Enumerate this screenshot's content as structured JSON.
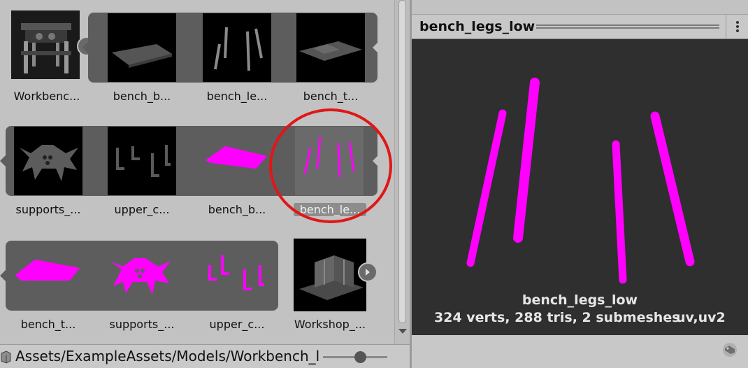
{
  "assets": {
    "row1": [
      {
        "name": "Workbenc...",
        "type": "prefab"
      },
      {
        "name": "bench_b...",
        "type": "mesh"
      },
      {
        "name": "bench_le...",
        "type": "mesh"
      },
      {
        "name": "bench_t...",
        "type": "mesh"
      }
    ],
    "row2": [
      {
        "name": "supports_...",
        "type": "mesh"
      },
      {
        "name": "upper_c...",
        "type": "mesh"
      },
      {
        "name": "bench_b...",
        "type": "mesh"
      },
      {
        "name": "bench_le...",
        "type": "mesh",
        "selected": true
      }
    ],
    "row3": [
      {
        "name": "bench_t...",
        "type": "mesh"
      },
      {
        "name": "supports_...",
        "type": "mesh"
      },
      {
        "name": "upper_c...",
        "type": "mesh"
      },
      {
        "name": "Workshop_...",
        "type": "prefab"
      }
    ]
  },
  "footer": {
    "path": "Assets/ExampleAssets/Models/Workbench_l",
    "icon": "package-icon"
  },
  "preview": {
    "title": "bench_legs_low",
    "mesh_name": "bench_legs_low",
    "stats": "324 verts, 288 tris, 2 submeshes",
    "uv": "uv,uv2",
    "menu_icon": "kebab-menu-icon",
    "tag_icon": "tag-icon"
  },
  "colors": {
    "magenta": "#ff00ff",
    "highlight_circle": "#e11616",
    "panel_bg": "#c2c2c2",
    "viewport_bg": "#2f2f2f"
  }
}
